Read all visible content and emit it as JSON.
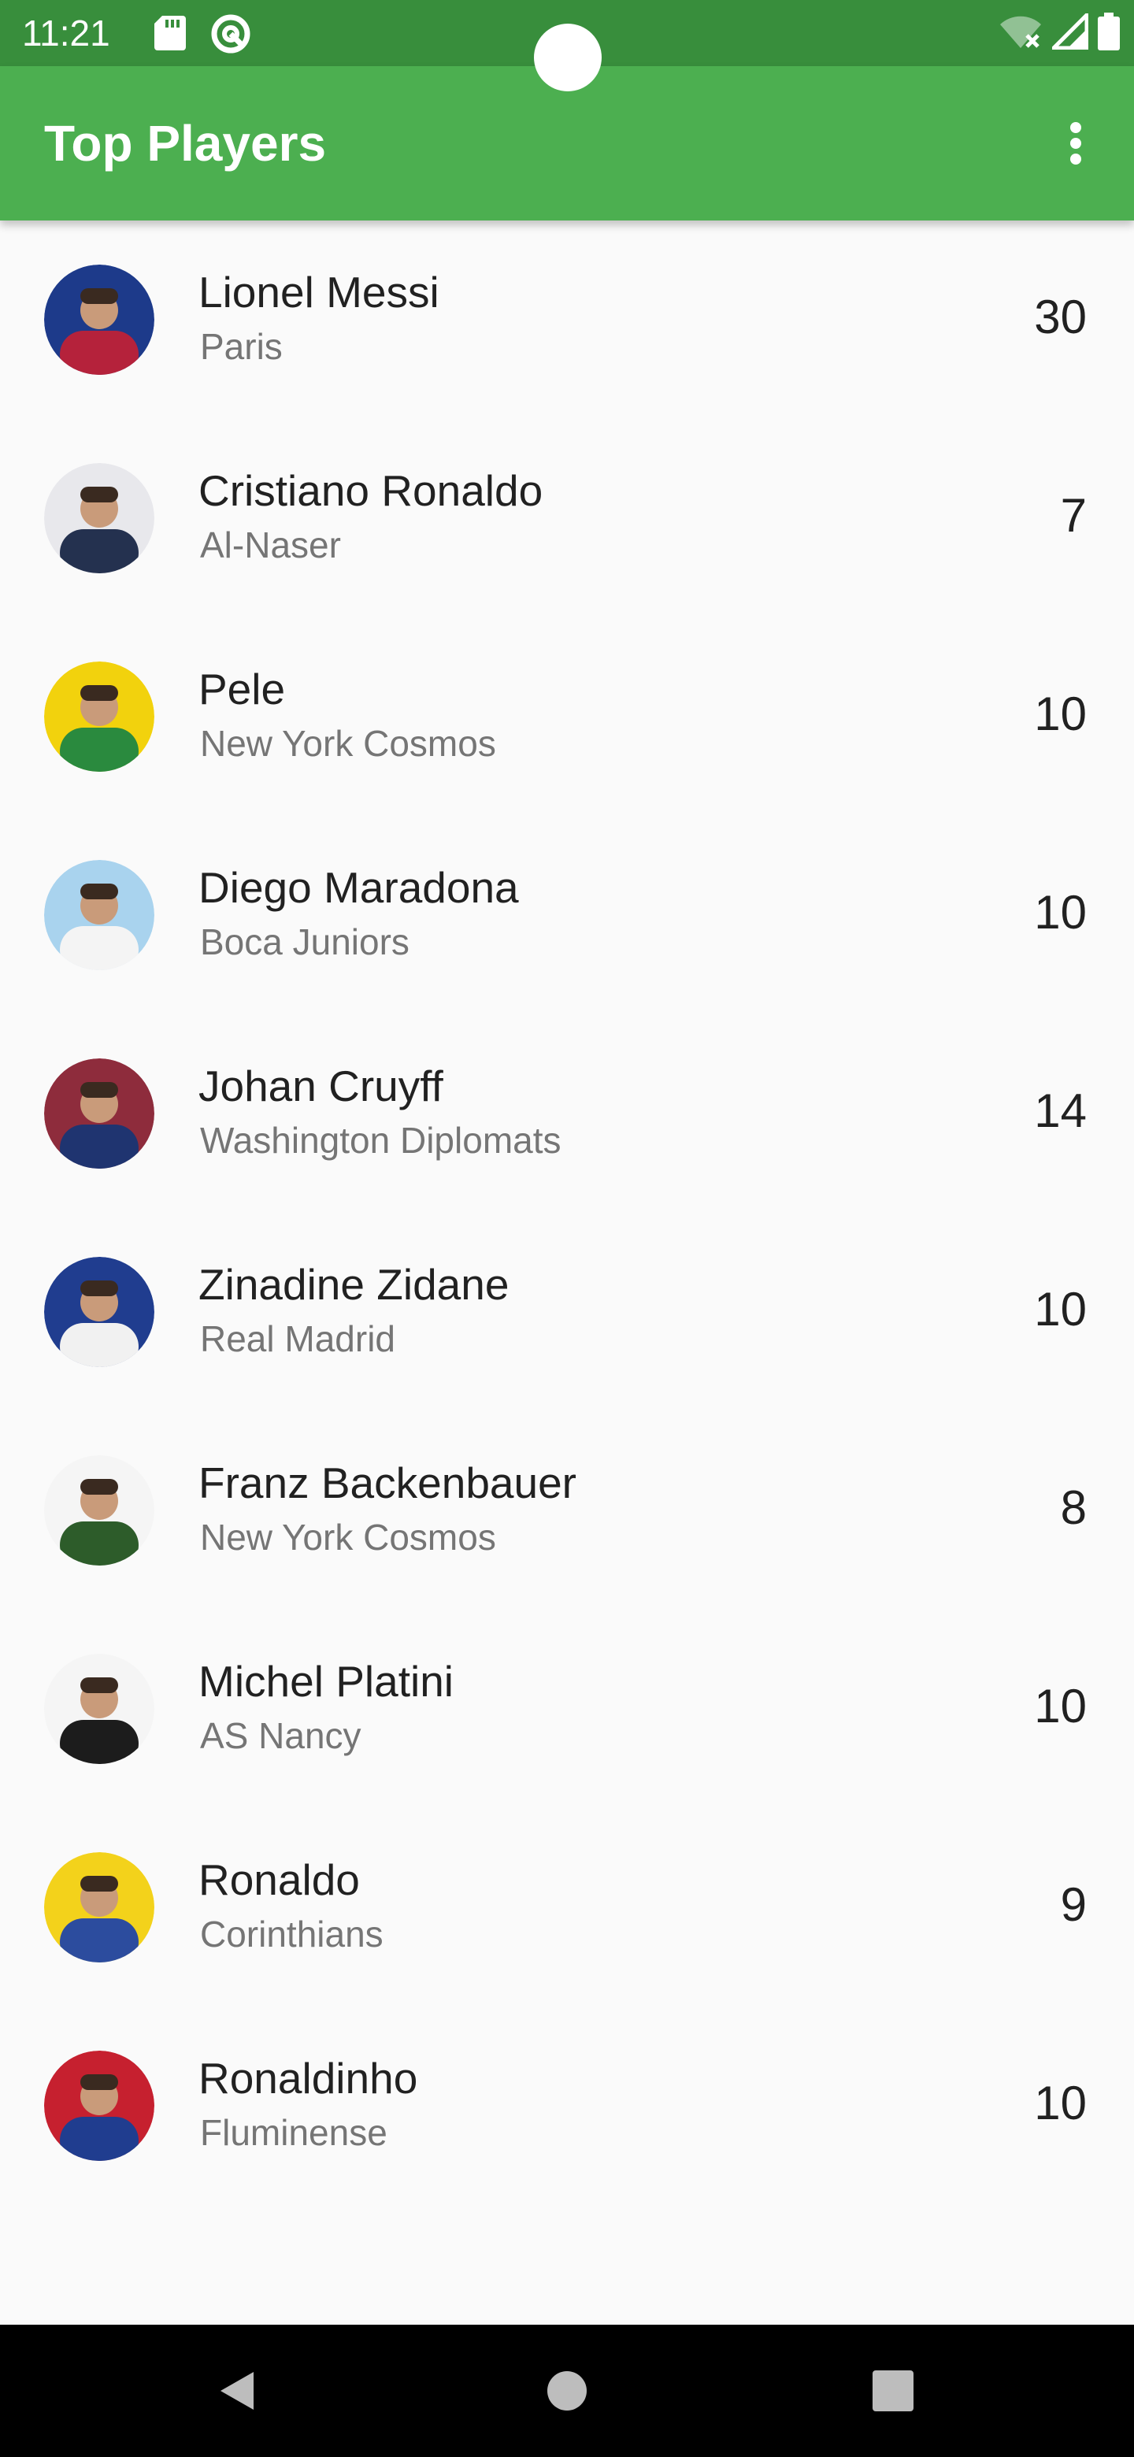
{
  "status_bar": {
    "time": "11:21",
    "icons": [
      "sd-card-icon",
      "at-sign-icon",
      "wifi-off-icon",
      "signal-icon",
      "battery-icon"
    ]
  },
  "app_bar": {
    "title": "Top Players",
    "menu_icon": "more-vertical-icon"
  },
  "players": [
    {
      "name": "Lionel Messi",
      "club": "Paris",
      "number": "30",
      "colors": [
        "#1d3a8a",
        "#b5223b"
      ]
    },
    {
      "name": "Cristiano Ronaldo",
      "club": "Al-Naser",
      "number": "7",
      "colors": [
        "#e8e8ec",
        "#24314f"
      ]
    },
    {
      "name": "Pele",
      "club": "New York Cosmos",
      "number": "10",
      "colors": [
        "#f2d20d",
        "#2a8a3e"
      ]
    },
    {
      "name": "Diego Maradona",
      "club": "Boca Juniors",
      "number": "10",
      "colors": [
        "#a9d3ee",
        "#f4f4f4"
      ]
    },
    {
      "name": "Johan Cruyff",
      "club": "Washington Diplomats",
      "number": "14",
      "colors": [
        "#8e2c3c",
        "#1f3470"
      ]
    },
    {
      "name": "Zinadine Zidane",
      "club": "Real Madrid",
      "number": "10",
      "colors": [
        "#203d8f",
        "#f1f1f1"
      ]
    },
    {
      "name": "Franz Backenbauer",
      "club": "New York Cosmos",
      "number": "8",
      "colors": [
        "#f5f5f5",
        "#2d5c2a"
      ]
    },
    {
      "name": "Michel Platini",
      "club": "AS Nancy",
      "number": "10",
      "colors": [
        "#f5f5f5",
        "#1c1c1c"
      ]
    },
    {
      "name": "Ronaldo",
      "club": "Corinthians",
      "number": "9",
      "colors": [
        "#f3d21b",
        "#2c4c9e"
      ]
    },
    {
      "name": "Ronaldinho",
      "club": "Fluminense",
      "number": "10",
      "colors": [
        "#c6202f",
        "#203d8f"
      ]
    }
  ],
  "nav_bar": {
    "icons": [
      "back-icon",
      "home-icon",
      "recents-icon"
    ]
  },
  "theme": {
    "primary": "#4caf50",
    "primary_dark": "#388e3c",
    "background": "#fafafa"
  }
}
